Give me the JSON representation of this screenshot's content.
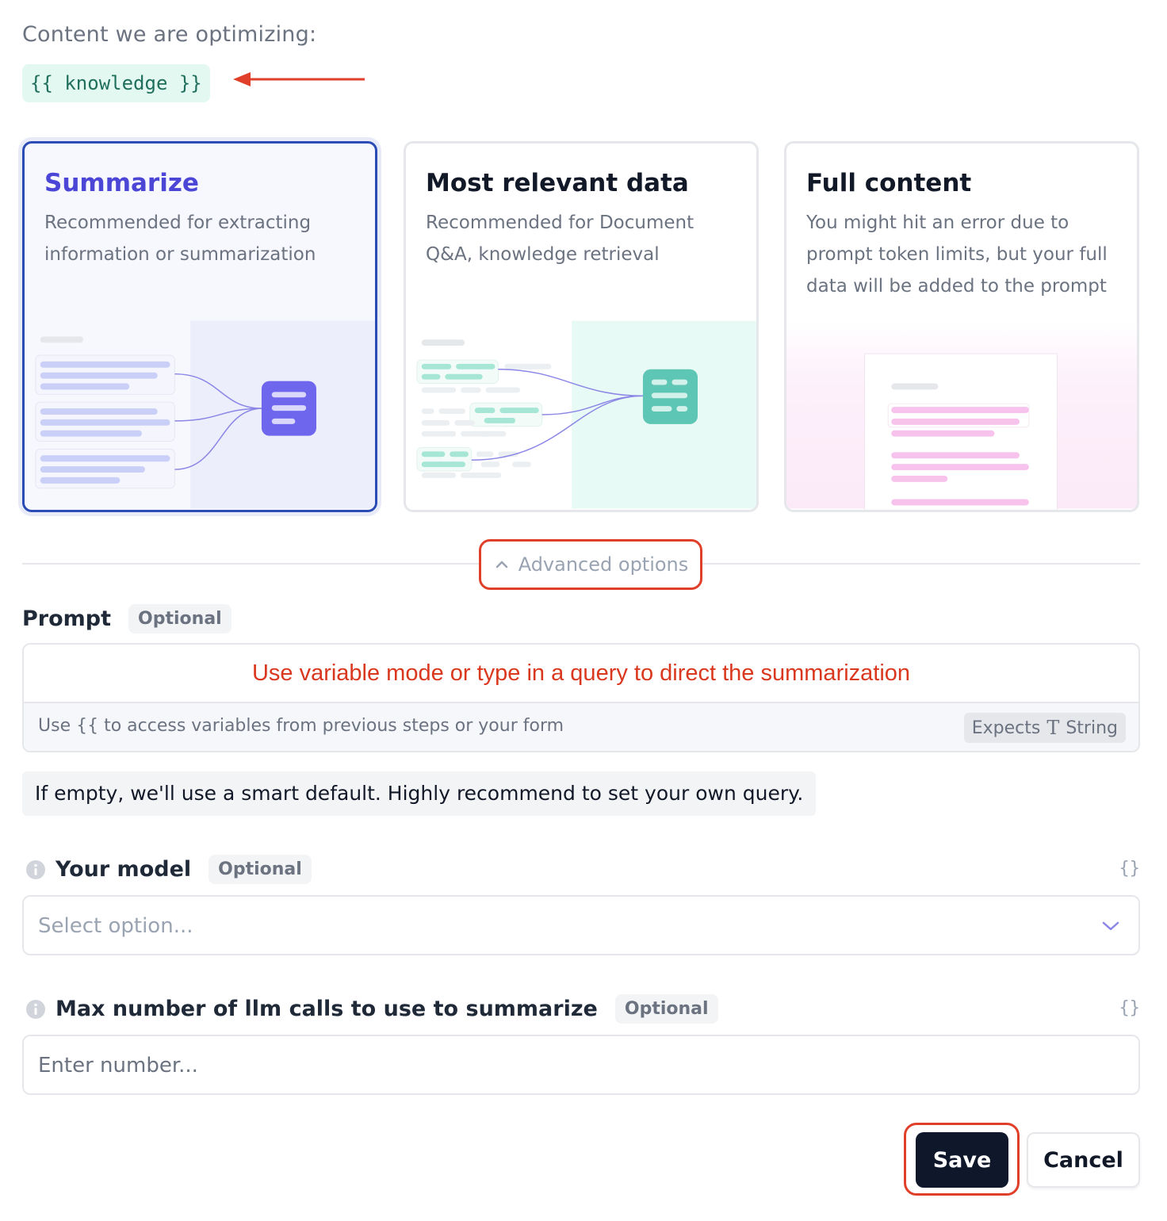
{
  "header": {
    "content_label": "Content we are optimizing:",
    "variable_pill": "{{ knowledge }}"
  },
  "options": [
    {
      "title": "Summarize",
      "description": "Recommended for extracting information or summarization",
      "selected": true
    },
    {
      "title": "Most relevant data",
      "description": "Recommended for Document Q&A, knowledge retrieval",
      "selected": false
    },
    {
      "title": "Full content",
      "description": "You might hit an error due to prompt token limits, but your full data will be added to the prompt",
      "selected": false
    }
  ],
  "advanced": {
    "label": "Advanced options",
    "icon": "chevron-up-icon"
  },
  "prompt": {
    "label": "Prompt",
    "optional": "Optional",
    "text": "Use variable mode or type in a query to direct the summarization",
    "hint": "Use {{ to access variables from previous steps or your form",
    "expects_label": "Expects",
    "type_glyph": "T",
    "expects_type": "String"
  },
  "note": "If empty, we'll use a smart default. Highly recommend to set your own query.",
  "model": {
    "label": "Your model",
    "optional": "Optional",
    "braces": "{}",
    "placeholder": "Select option..."
  },
  "max_calls": {
    "label": "Max number of llm calls to use to summarize",
    "optional": "Optional",
    "braces": "{}",
    "placeholder": "Enter number..."
  },
  "actions": {
    "save": "Save",
    "cancel": "Cancel"
  },
  "colors": {
    "accent": "#4b46d6",
    "selected_border": "#2b4bb5",
    "annotation_red": "#e0402a",
    "save_bg": "#0f172a",
    "pill_green": "#e3f8f1"
  }
}
